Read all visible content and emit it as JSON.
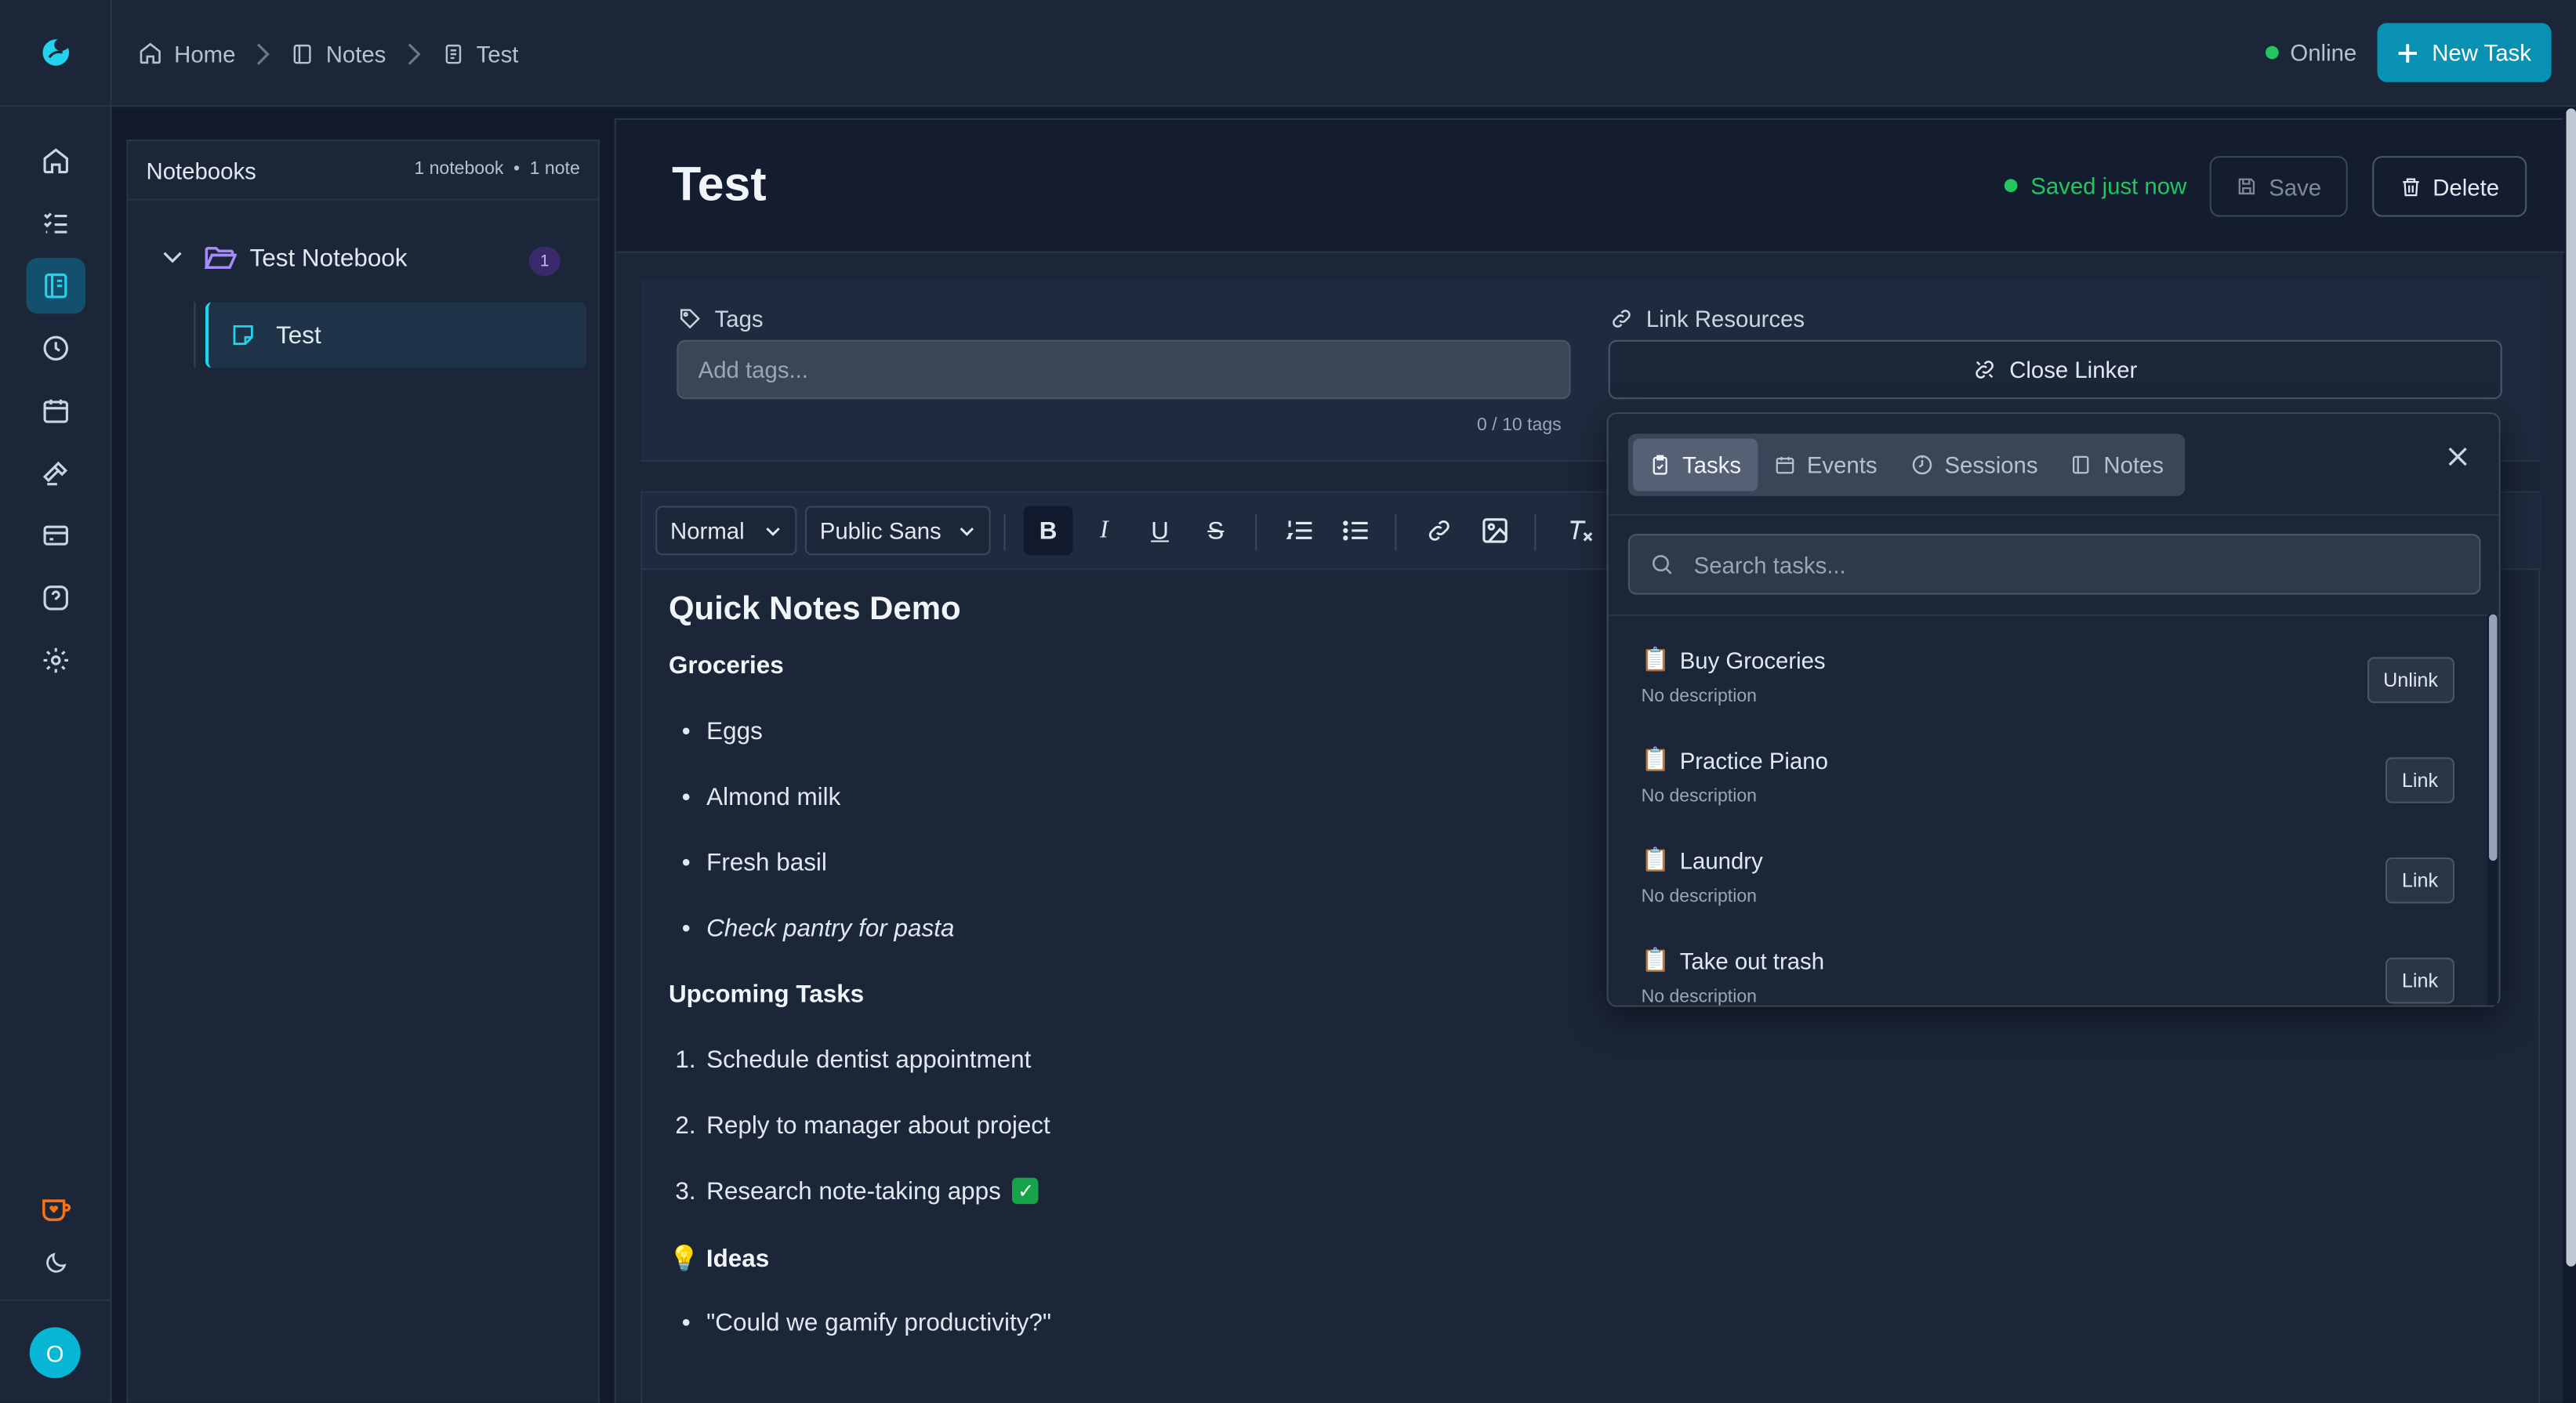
{
  "breadcrumb": [
    {
      "label": "Home",
      "icon": "home-icon"
    },
    {
      "label": "Notes",
      "icon": "notes-icon"
    },
    {
      "label": "Test",
      "icon": "document-icon"
    }
  ],
  "header": {
    "status": "Online",
    "new_task_label": "New Task"
  },
  "sidebar": {
    "items": [
      {
        "name": "home",
        "icon": "home-icon"
      },
      {
        "name": "tasks",
        "icon": "list-checks-icon"
      },
      {
        "name": "notes",
        "icon": "notebook-icon",
        "active": true
      },
      {
        "name": "history",
        "icon": "clock-icon"
      },
      {
        "name": "calendar",
        "icon": "calendar-icon"
      },
      {
        "name": "tools",
        "icon": "hammer-icon"
      },
      {
        "name": "billing",
        "icon": "card-icon"
      },
      {
        "name": "help",
        "icon": "help-icon"
      },
      {
        "name": "settings",
        "icon": "gear-icon"
      }
    ],
    "user_initial": "O"
  },
  "notebooks": {
    "title": "Notebooks",
    "notebook_count": "1 notebook",
    "note_count": "1 note",
    "notebook_name": "Test Notebook",
    "notebook_badge": "1",
    "note_name": "Test"
  },
  "note": {
    "title": "Test",
    "saved_status": "Saved just now",
    "save_label": "Save",
    "delete_label": "Delete"
  },
  "tags": {
    "label": "Tags",
    "placeholder": "Add tags...",
    "count": "0 / 10 tags"
  },
  "link_resources": {
    "label": "Link Resources",
    "close_label": "Close Linker",
    "tabs": [
      "Tasks",
      "Events",
      "Sessions",
      "Notes"
    ],
    "active_tab": "Tasks",
    "search_placeholder": "Search tasks...",
    "items": [
      {
        "title": "Buy Groceries",
        "description": "No description",
        "action": "Unlink"
      },
      {
        "title": "Practice Piano",
        "description": "No description",
        "action": "Link"
      },
      {
        "title": "Laundry",
        "description": "No description",
        "action": "Link"
      },
      {
        "title": "Take out trash",
        "description": "No description",
        "action": "Link"
      }
    ]
  },
  "toolbar": {
    "block_style": "Normal",
    "font": "Public Sans"
  },
  "document": {
    "heading": "Quick Notes Demo",
    "groceries_heading": "Groceries",
    "groceries": [
      "Eggs",
      "Almond milk",
      "Fresh basil"
    ],
    "groceries_italic": "Check pantry for pasta",
    "tasks_heading": "Upcoming Tasks",
    "tasks": [
      "Schedule dentist appointment",
      "Reply to manager about project",
      "Research note-taking apps"
    ],
    "ideas_heading": "Ideas",
    "ideas": [
      "\"Could we gamify productivity?\""
    ]
  }
}
